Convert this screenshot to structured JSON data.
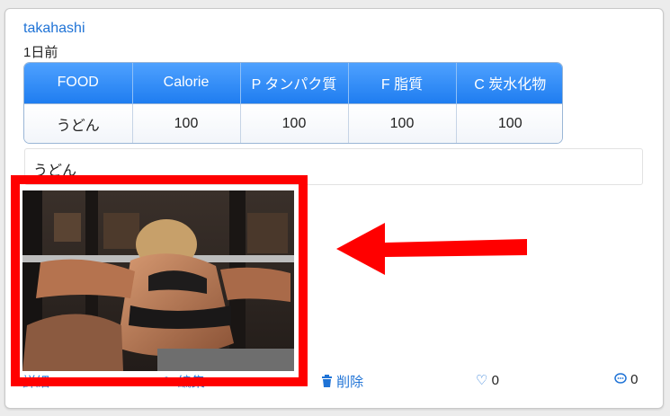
{
  "post": {
    "username": "takahashi",
    "time": "1日前",
    "nutrition_table": {
      "headers": [
        "FOOD",
        "Calorie",
        "P タンパク質",
        "F 脂質",
        "C 炭水化物"
      ],
      "row": [
        "うどん",
        "100",
        "100",
        "100",
        "100"
      ]
    },
    "memo": "うどん",
    "actions": {
      "detail": "詳細",
      "edit": "編集",
      "delete": "削除",
      "like_count": "0",
      "comment_count": "0"
    }
  },
  "colors": {
    "link": "#1f73d6",
    "table_header": "#1f7df0",
    "annotation": "#ff0000"
  },
  "annotation": {
    "highlight": "red-box-around-photo",
    "arrow": "red-arrow-pointing-left"
  }
}
